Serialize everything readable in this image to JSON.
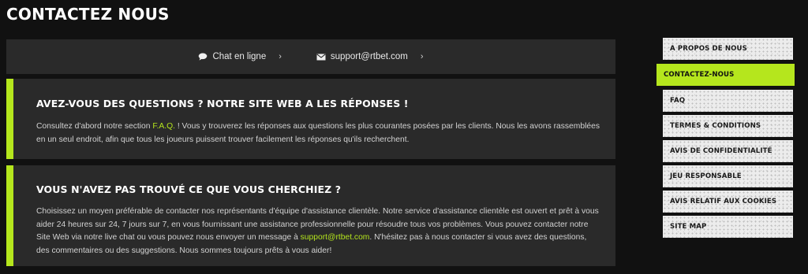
{
  "page": {
    "title": "CONTACTEZ NOUS"
  },
  "contact_bar": {
    "chat_label": "Chat en ligne",
    "email_label": "support@rtbet.com",
    "chevron": "›"
  },
  "faq_card": {
    "heading": "AVEZ-VOUS DES QUESTIONS ? NOTRE SITE WEB A LES RÉPONSES !",
    "text_before": "Consultez d'abord notre section ",
    "link": "F.A.Q.",
    "text_after": " ! Vous y trouverez les réponses aux questions les plus courantes posées par les clients. Nous les avons rassemblées en un seul endroit, afin que tous les joueurs puissent trouver facilement les réponses qu'ils recherchent."
  },
  "support_card": {
    "heading": "VOUS N'AVEZ PAS TROUVÉ CE QUE VOUS CHERCHIEZ ?",
    "text_before": "Choisissez un moyen préférable de contacter nos représentants d'équipe d'assistance clientèle. Notre service d'assistance clientèle est ouvert et prêt à vous aider 24 heures sur 24, 7 jours sur 7, en vous fournissant une assistance professionnelle pour résoudre tous vos problèmes. Vous pouvez contacter notre Site Web via notre live chat ou vous pouvez nous envoyer un message à ",
    "link": "support@rtbet.com",
    "text_after": ". N'hésitez pas à nous contacter si vous avez des questions, des commentaires ou des suggestions. Nous sommes toujours prêts à vous aider!"
  },
  "sidebar": {
    "items": [
      {
        "label": "A PROPOS DE NOUS"
      },
      {
        "label": "CONTACTEZ-NOUS",
        "active": true
      },
      {
        "label": "FAQ"
      },
      {
        "label": "TERMES & CONDITIONS"
      },
      {
        "label": "AVIS DE CONFIDENTIALITÉ"
      },
      {
        "label": "JEU RESPONSABLE"
      },
      {
        "label": "AVIS RELATIF AUX COOKIES"
      },
      {
        "label": "SITE MAP"
      }
    ]
  },
  "colors": {
    "accent": "#b5e61d",
    "panel": "#2a2a2a",
    "background": "#111111"
  },
  "icons": {
    "chat": "chat-bubble-icon",
    "email": "envelope-icon"
  }
}
